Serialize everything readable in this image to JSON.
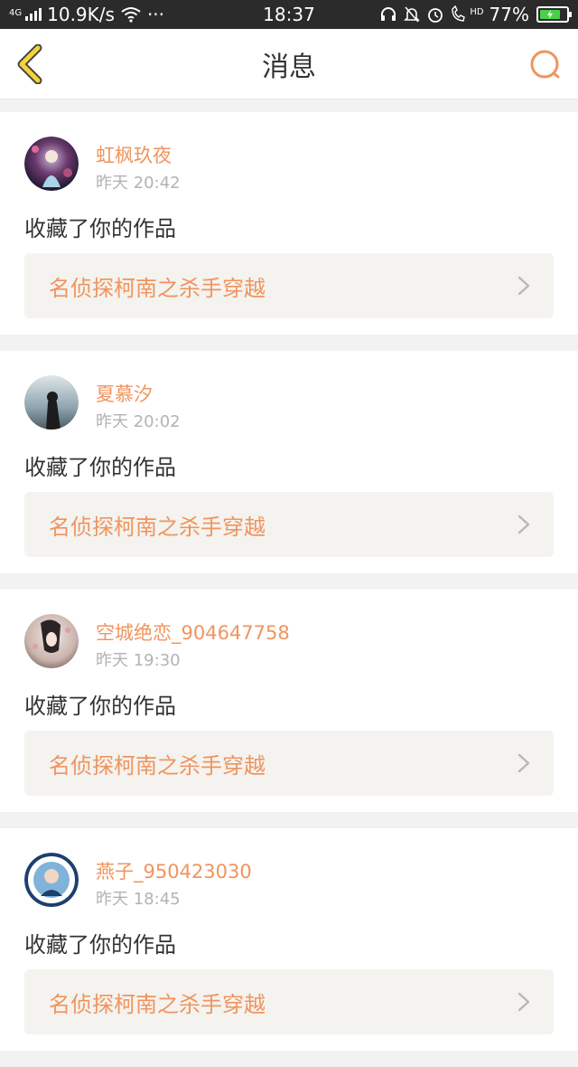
{
  "status_bar": {
    "network_type": "4G",
    "speed": "10.9K/s",
    "more": "···",
    "time": "18:37",
    "hd_label": "HD",
    "battery_percent": "77%",
    "battery_level": 0.77
  },
  "header": {
    "title": "消息",
    "back_icon": "chevron-left-icon",
    "search_icon": "search-icon",
    "accent_color": "#f5d43b",
    "search_color": "#f0945f"
  },
  "messages": [
    {
      "username": "虹枫玖夜",
      "time": "昨天 20:42",
      "action": "收藏了你的作品",
      "work_title": "名侦探柯南之杀手穿越"
    },
    {
      "username": "夏慕汐",
      "time": "昨天 20:02",
      "action": "收藏了你的作品",
      "work_title": "名侦探柯南之杀手穿越"
    },
    {
      "username": "空城绝恋_904647758",
      "time": "昨天 19:30",
      "action": "收藏了你的作品",
      "work_title": "名侦探柯南之杀手穿越"
    },
    {
      "username": "燕子_950423030",
      "time": "昨天 18:45",
      "action": "收藏了你的作品",
      "work_title": "名侦探柯南之杀手穿越"
    }
  ],
  "colors": {
    "username": "#f0945f",
    "work_title": "#f0945f",
    "work_box_bg": "#f4f3ef",
    "time": "#b3b3b3"
  }
}
